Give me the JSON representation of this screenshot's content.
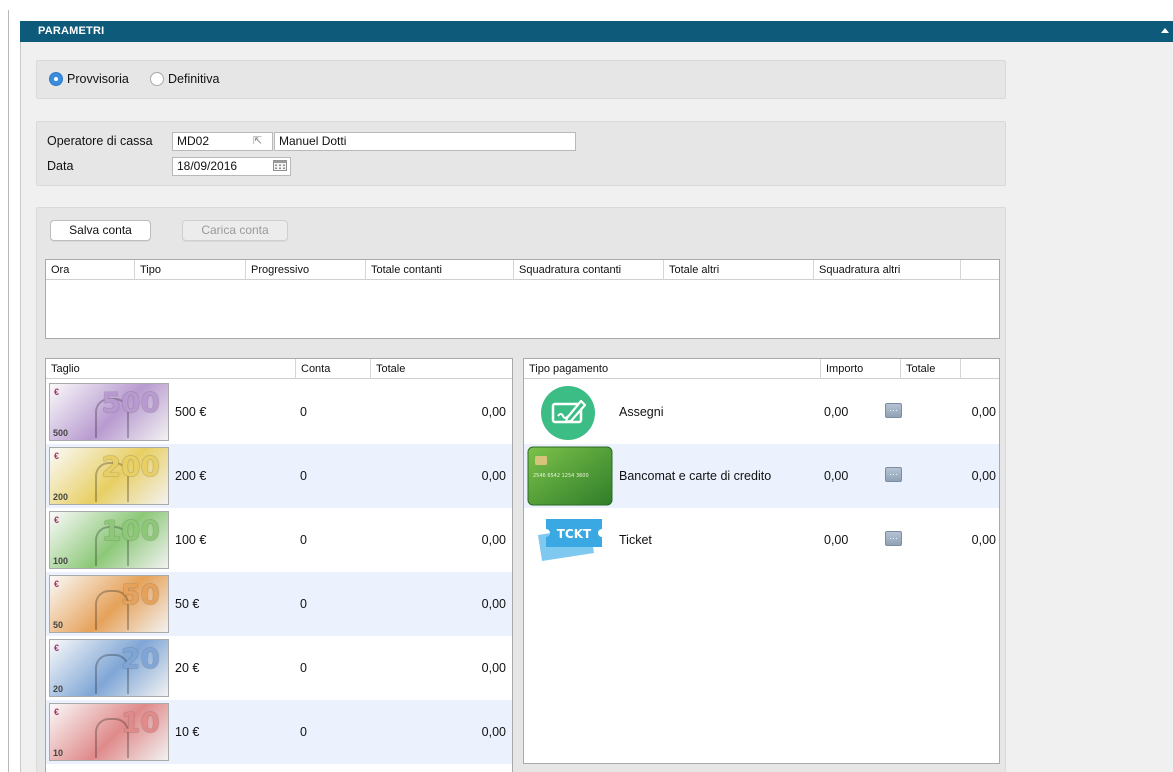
{
  "header": {
    "title": "PARAMETRI"
  },
  "mode": {
    "options": [
      {
        "label": "Provvisoria",
        "selected": true
      },
      {
        "label": "Definitiva",
        "selected": false
      }
    ]
  },
  "form": {
    "operator_label": "Operatore di cassa",
    "operator_code": "MD02",
    "operator_name": "Manuel Dotti",
    "date_label": "Data",
    "date_value": "18/09/2016"
  },
  "actions": {
    "save_label": "Salva conta",
    "load_label": "Carica conta"
  },
  "history_table": {
    "columns": [
      "Ora",
      "Tipo",
      "Progressivo",
      "Totale contanti",
      "Squadratura contanti",
      "Totale altri",
      "Squadratura altri"
    ],
    "rows": []
  },
  "cash_table": {
    "columns": [
      "Taglio",
      "Conta",
      "Totale"
    ],
    "rows": [
      {
        "denomination": "500 €",
        "count": "0",
        "total": "0,00",
        "bill_value": "500",
        "color": "#b89ad0"
      },
      {
        "denomination": "200 €",
        "count": "0",
        "total": "0,00",
        "bill_value": "200",
        "color": "#e8cf63"
      },
      {
        "denomination": "100 €",
        "count": "0",
        "total": "0,00",
        "bill_value": "100",
        "color": "#8cc878"
      },
      {
        "denomination": "50 €",
        "count": "0",
        "total": "0,00",
        "bill_value": "50",
        "color": "#e6a25a"
      },
      {
        "denomination": "20 €",
        "count": "0",
        "total": "0,00",
        "bill_value": "20",
        "color": "#7fa6d6"
      },
      {
        "denomination": "10 €",
        "count": "0",
        "total": "0,00",
        "bill_value": "10",
        "color": "#e08a8a"
      }
    ]
  },
  "payment_table": {
    "columns": [
      "Tipo pagamento",
      "Importo",
      "Totale"
    ],
    "rows": [
      {
        "type": "Assegni",
        "amount": "0,00",
        "total": "0,00",
        "icon": "check-icon"
      },
      {
        "type": "Bancomat e carte di credito",
        "amount": "0,00",
        "total": "0,00",
        "icon": "credit-card-icon",
        "card_number": "2546 6542 1254 3600"
      },
      {
        "type": "Ticket",
        "amount": "0,00",
        "total": "0,00",
        "icon": "ticket-icon",
        "ticket_text": "TCKT"
      }
    ]
  },
  "colors": {
    "header_bg": "#0d5a7a",
    "radio_on": "#3a8dde",
    "row_alt": "#ebf2fd"
  }
}
